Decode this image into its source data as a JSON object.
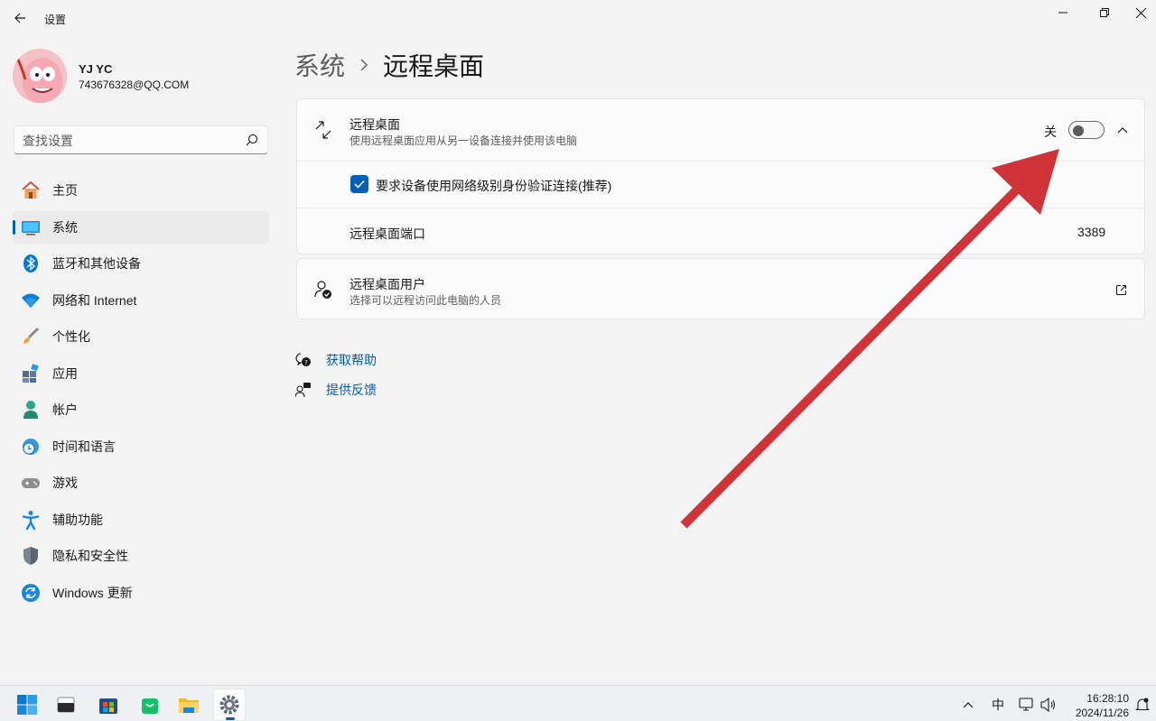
{
  "app": {
    "title": "设置"
  },
  "window_controls": {
    "minimize": "minimize-icon",
    "maximize": "restore-icon",
    "close": "close-icon"
  },
  "profile": {
    "name": "YJ YC",
    "email": "743676328@QQ.COM"
  },
  "search": {
    "placeholder": "查找设置"
  },
  "nav": {
    "items": [
      {
        "label": "主页",
        "icon": "home-icon"
      },
      {
        "label": "系统",
        "icon": "system-icon",
        "active": true
      },
      {
        "label": "蓝牙和其他设备",
        "icon": "bluetooth-icon"
      },
      {
        "label": "网络和 Internet",
        "icon": "wifi-icon"
      },
      {
        "label": "个性化",
        "icon": "brush-icon"
      },
      {
        "label": "应用",
        "icon": "apps-icon"
      },
      {
        "label": "帐户",
        "icon": "account-icon"
      },
      {
        "label": "时间和语言",
        "icon": "time-language-icon"
      },
      {
        "label": "游戏",
        "icon": "gamepad-icon"
      },
      {
        "label": "辅助功能",
        "icon": "accessibility-icon"
      },
      {
        "label": "隐私和安全性",
        "icon": "shield-icon"
      },
      {
        "label": "Windows 更新",
        "icon": "update-icon"
      }
    ]
  },
  "breadcrumb": {
    "parent": "系统",
    "current": "远程桌面"
  },
  "remote_desktop": {
    "title": "远程桌面",
    "subtitle": "使用远程桌面应用从另一设备连接并使用该电脑",
    "toggle_state": "关",
    "toggle_on": false,
    "nla_checkbox_label": "要求设备使用网络级别身份验证连接(推荐)",
    "nla_checked": true,
    "port_label": "远程桌面端口",
    "port_value": "3389"
  },
  "remote_users": {
    "title": "远程桌面用户",
    "subtitle": "选择可以远程访问此电脑的人员"
  },
  "help": {
    "get_help": "获取帮助",
    "feedback": "提供反馈"
  },
  "taskbar": {
    "apps": [
      "start-icon",
      "terminal-icon",
      "store-icon",
      "shopping-bag-icon",
      "file-explorer-icon",
      "settings-icon"
    ],
    "tray": {
      "ime": "中",
      "time": "16:28:10",
      "date": "2024/11/26"
    }
  },
  "colors": {
    "accent": "#005fb8",
    "annotation_arrow": "#d13438"
  }
}
